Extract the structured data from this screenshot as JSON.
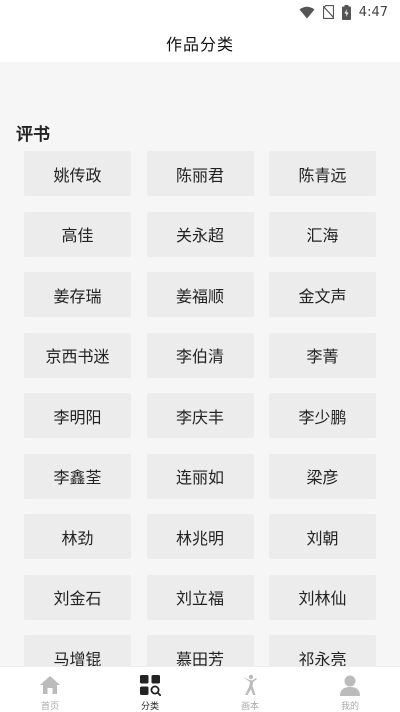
{
  "status_bar": {
    "time": "4:47"
  },
  "header": {
    "title": "作品分类"
  },
  "section": {
    "title": "评书",
    "items": [
      "姚传政",
      "陈丽君",
      "陈青远",
      "高佳",
      "关永超",
      "汇海",
      "姜存瑞",
      "姜福顺",
      "金文声",
      "京西书迷",
      "李伯清",
      "李菁",
      "李明阳",
      "李庆丰",
      "李少鹏",
      "李鑫荃",
      "连丽如",
      "梁彦",
      "林劲",
      "林兆明",
      "刘朝",
      "刘金石",
      "刘立福",
      "刘林仙",
      "马增锟",
      "慕田芳",
      "祁永亮"
    ]
  },
  "bottom_nav": {
    "items": [
      {
        "label": "首页",
        "icon": "home-icon",
        "active": false
      },
      {
        "label": "分类",
        "icon": "category-icon",
        "active": true
      },
      {
        "label": "画本",
        "icon": "dancer-icon",
        "active": false
      },
      {
        "label": "我的",
        "icon": "user-icon",
        "active": false
      }
    ]
  },
  "colors": {
    "active": "#222222",
    "inactive": "#bbbbbb",
    "cell_bg": "#ececec"
  }
}
